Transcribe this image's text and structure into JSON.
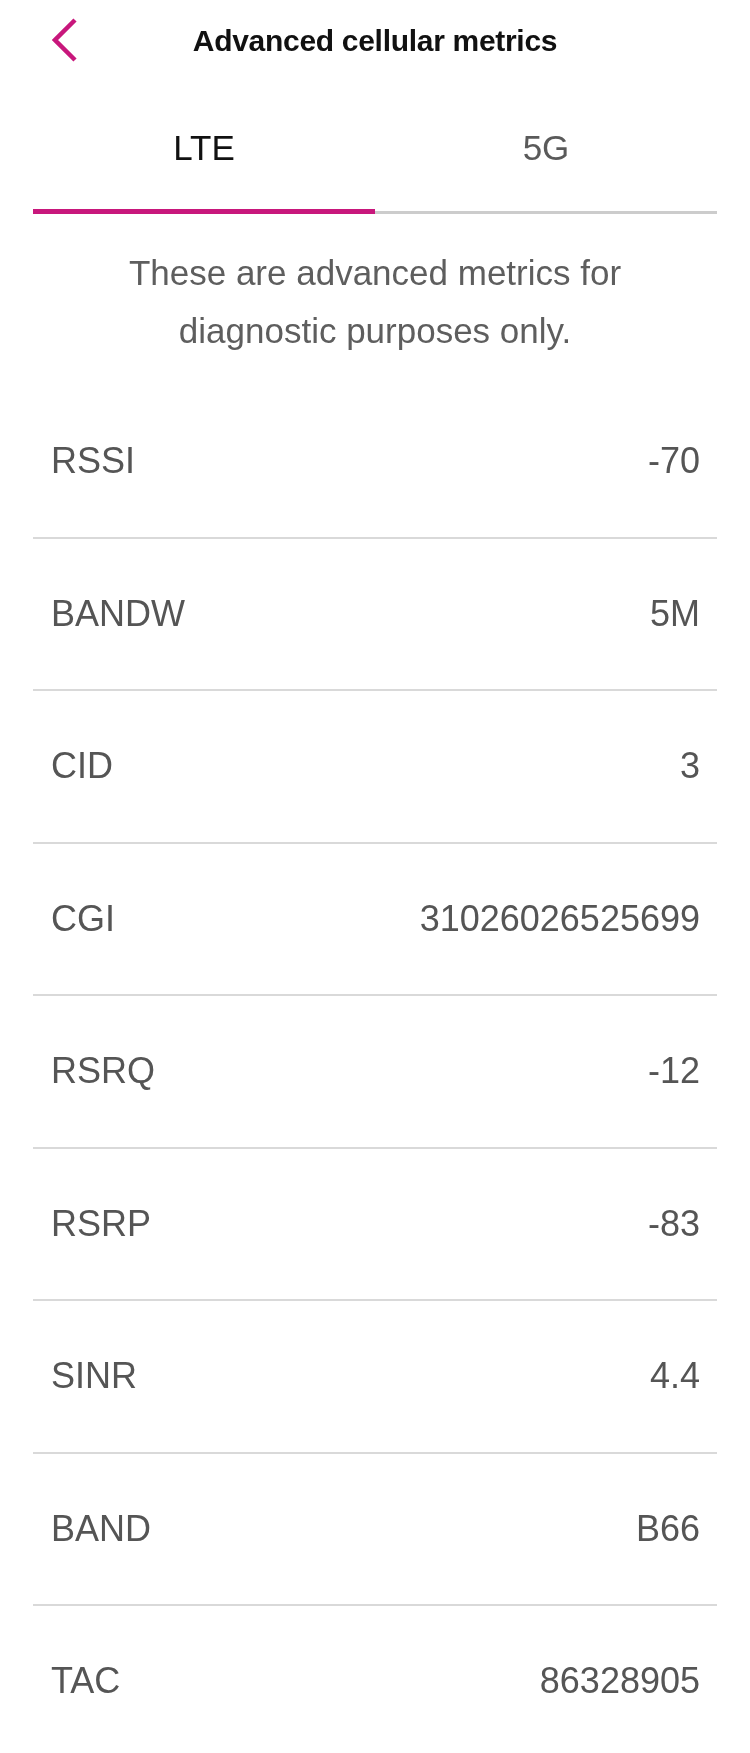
{
  "header": {
    "title": "Advanced cellular metrics"
  },
  "tabs": [
    {
      "label": "LTE",
      "selected": true
    },
    {
      "label": "5G",
      "selected": false
    }
  ],
  "description": "These are advanced metrics for diagnostic purposes only.",
  "metrics": [
    {
      "label": "RSSI",
      "value": "-70"
    },
    {
      "label": "BANDW",
      "value": "5M"
    },
    {
      "label": "CID",
      "value": "3"
    },
    {
      "label": "CGI",
      "value": "31026026525699"
    },
    {
      "label": "RSRQ",
      "value": "-12"
    },
    {
      "label": "RSRP",
      "value": "-83"
    },
    {
      "label": "SINR",
      "value": "4.4"
    },
    {
      "label": "BAND",
      "value": "B66"
    },
    {
      "label": "TAC",
      "value": "86328905"
    }
  ]
}
